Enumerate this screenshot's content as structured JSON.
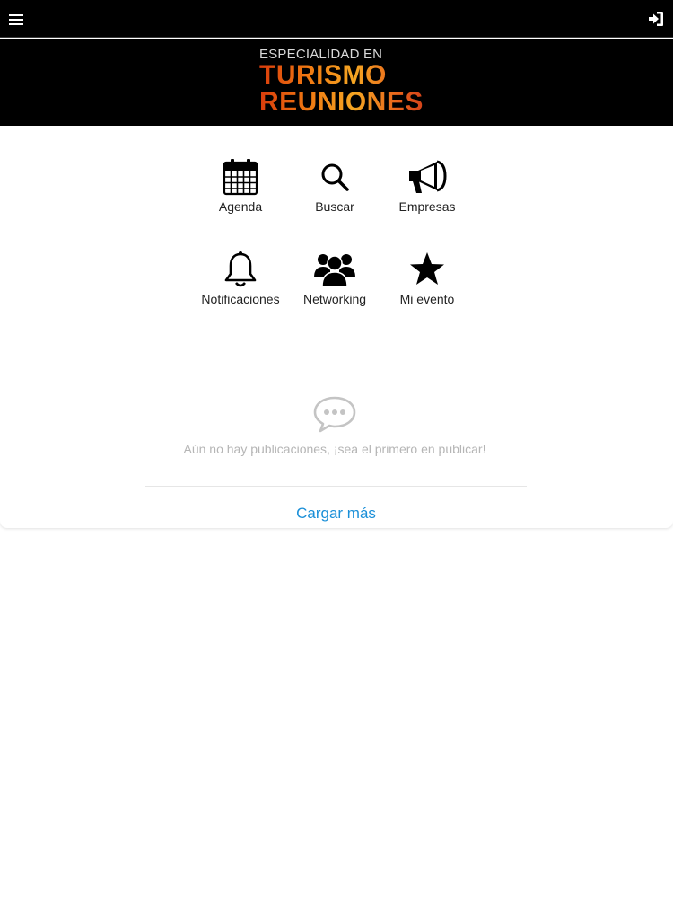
{
  "header": {
    "menu_icon": "hamburger-menu-icon",
    "login_icon": "sign-in-icon"
  },
  "banner": {
    "logo_line1": "ESPECIALIDAD EN",
    "logo_line2": "TURISMO",
    "logo_line3": "REUNIONES",
    "logo_colors": [
      "#d8380b",
      "#f07a12",
      "#f5a623"
    ]
  },
  "menu": {
    "items": [
      {
        "label": "Agenda",
        "icon": "calendar-icon"
      },
      {
        "label": "Buscar",
        "icon": "search-icon"
      },
      {
        "label": "Empresas",
        "icon": "megaphone-icon"
      },
      {
        "label": "Notificaciones",
        "icon": "bell-icon"
      },
      {
        "label": "Networking",
        "icon": "people-icon"
      },
      {
        "label": "Mi evento",
        "icon": "star-icon"
      }
    ]
  },
  "feed": {
    "empty_icon": "speech-bubble-icon",
    "empty_message": "Aún no hay publicaciones, ¡sea el primero en publicar!",
    "load_more": "Cargar más"
  },
  "colors": {
    "header_bg": "#000000",
    "link": "#1a8fd8",
    "muted_text": "#b5b5b5"
  }
}
